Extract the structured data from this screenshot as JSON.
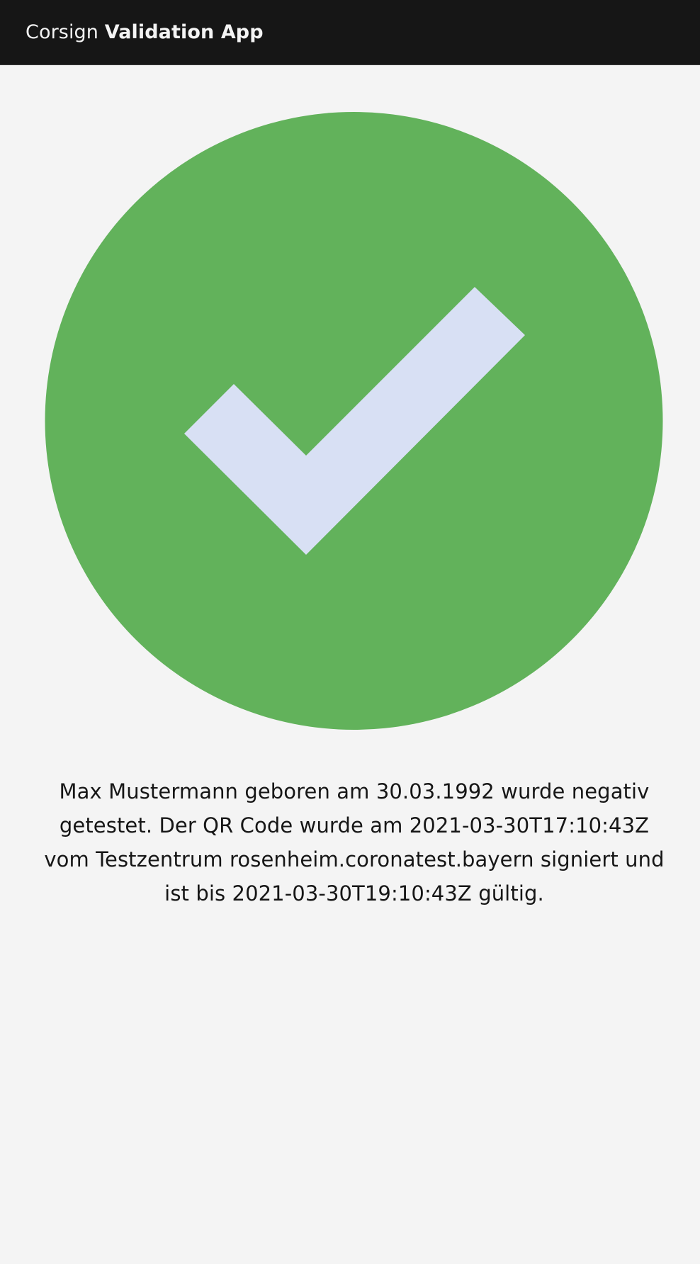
{
  "header": {
    "prefix": "Corsign",
    "product": "Validation App"
  },
  "status": {
    "icon": "checkmark-filled-icon",
    "state": "valid",
    "circle_color": "#62b25b",
    "check_color": "#d8e0f4"
  },
  "message": {
    "text": "Max Mustermann geboren am 30.03.1992 wurde negativ getestet. Der QR Code wurde am 2021-03-30T17:10:43Z vom Testzentrum rosenheim.coronatest.bayern signiert und ist bis 2021-03-30T19:10:43Z gültig."
  }
}
